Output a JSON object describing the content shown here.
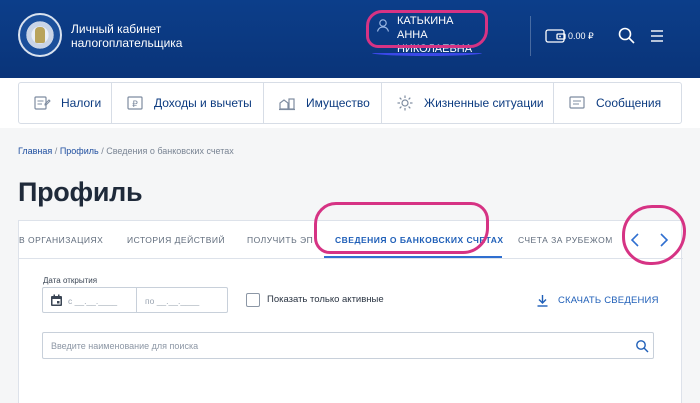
{
  "header": {
    "title_line1": "Личный кабинет",
    "title_line2": "налогоплательщика",
    "user_name_line1": "КАТЬКИНА АННА",
    "user_name_line2": "НИКОЛАЕВНА",
    "balance": "0.00 ₽",
    "icons": {
      "logo": "fns-emblem",
      "user": "user-icon",
      "wallet": "wallet-icon",
      "search": "search-icon",
      "menu": "menu-icon"
    }
  },
  "nav": {
    "items": [
      {
        "label": "Налоги",
        "icon": "taxes-icon"
      },
      {
        "label": "Доходы и вычеты",
        "icon": "income-icon"
      },
      {
        "label": "Имущество",
        "icon": "property-icon"
      },
      {
        "label": "Жизненные ситуации",
        "icon": "life-situations-icon"
      },
      {
        "label": "Сообщения",
        "icon": "messages-icon"
      }
    ]
  },
  "breadcrumb": {
    "home": "Главная",
    "profile": "Профиль",
    "current": "Сведения о банковских счетах",
    "separator": "/"
  },
  "page_title": "Профиль",
  "tabs": {
    "items": [
      {
        "label": "В ОРГАНИЗАЦИЯХ"
      },
      {
        "label": "ИСТОРИЯ ДЕЙСТВИЙ"
      },
      {
        "label": "ПОЛУЧИТЬ ЭП"
      },
      {
        "label": "СВЕДЕНИЯ О БАНКОВСКИХ СЧЕТАХ"
      },
      {
        "label": "СЧЕТА ЗА РУБЕЖОМ"
      }
    ],
    "active_index": 3
  },
  "filters": {
    "date_label": "Дата открытия",
    "date_from": "с __.__.____",
    "date_to": "по __.__.____",
    "checkbox_label": "Показать только активные",
    "checkbox_checked": false,
    "download_label": "СКАЧАТЬ СВЕДЕНИЯ",
    "search_placeholder": "Введите наименование для поиска",
    "search_value": ""
  },
  "colors": {
    "header_bg": "#0c3e8a",
    "accent_blue": "#1f5fb8",
    "annotation_pink": "#d63384",
    "annotation_blue": "#3a48e8"
  }
}
